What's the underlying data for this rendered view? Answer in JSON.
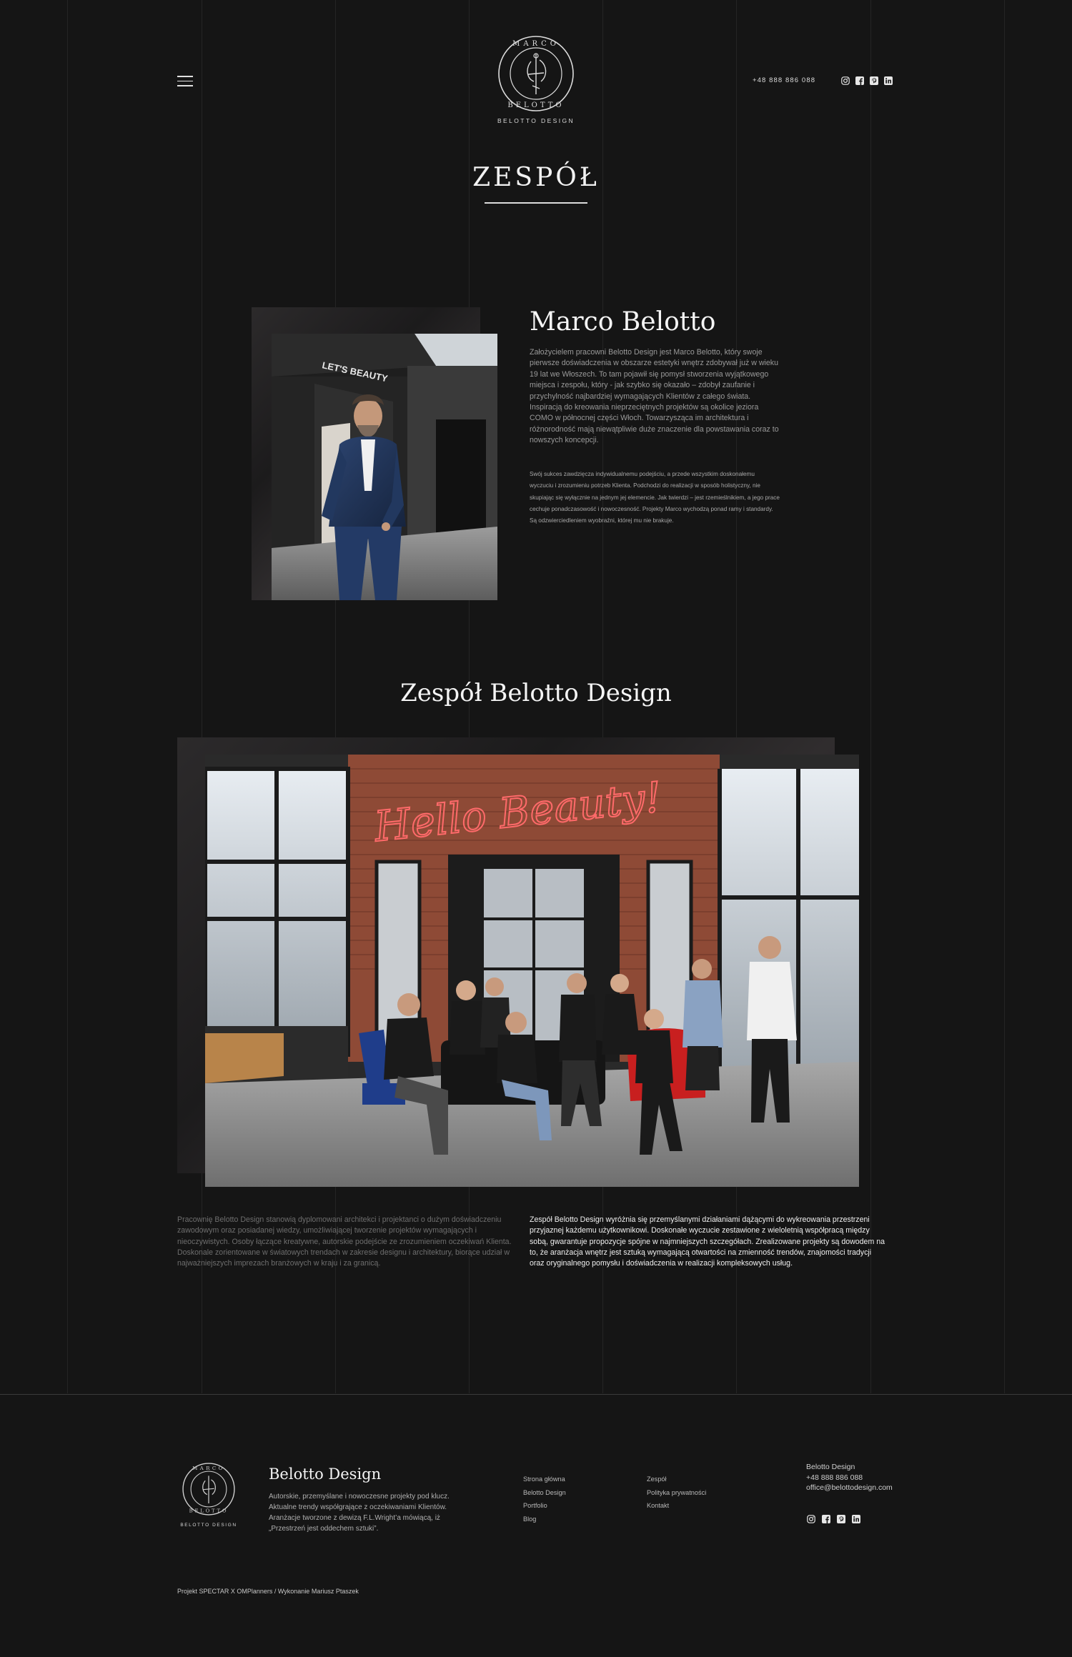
{
  "header": {
    "logo_sub": "BELOTTO DESIGN",
    "phone": "+48 888 886 088",
    "social_icons": [
      "instagram-icon",
      "facebook-icon",
      "pinterest-icon",
      "linkedin-icon"
    ]
  },
  "page_title": "ZESPÓŁ",
  "marco": {
    "name": "Marco Belotto",
    "paragraph1": "Założycielem pracowni Belotto Design jest Marco Belotto, który swoje pierwsze doświadczenia w obszarze estetyki wnętrz zdobywał już w wieku 19 lat we Włoszech. To tam pojawił się pomysł stworzenia wyjątkowego miejsca i zespołu, który - jak szybko się okazało – zdobył zaufanie i przychylność najbardziej wymagających Klientów z całego świata. Inspiracją do kreowania nieprzeciętnych projektów są okolice jeziora COMO w północnej części Włoch. Towarzysząca im architektura i różnorodność mają niewątpliwie duże znaczenie dla powstawania coraz to nowszych koncepcji.",
    "paragraph2": "Swój sukces zawdzięcza indywidualnemu podejściu, a przede wszystkim doskonałemu wyczuciu i zrozumieniu potrzeb Klienta. Podchodzi do realizacji w sposób holistyczny, nie skupiając się wyłącznie na jednym jej elemencie. Jak twierdzi – jest rzemieślnikiem, a jego prace cechuje ponadczasowość i nowoczesność. Projekty Marco wychodzą ponad ramy i standardy. Są odzwierciedleniem wyobraźni, której mu nie brakuje.",
    "photo_sign": "LET'S BEAUTY"
  },
  "team": {
    "title": "Zespół Belotto Design",
    "neon_text": "Hello Beauty!",
    "left_text": "Pracownię Belotto Design stanowią dyplomowani architekci i projektanci o dużym doświadczeniu zawodowym oraz posiadanej wiedzy, umożliwiającej tworzenie projektów wymagających i nieoczywistych. Osoby łączące kreatywne, autorskie podejście ze zrozumieniem oczekiwań Klienta. Doskonale zorientowane w światowych trendach w zakresie designu i architektury, biorące udział w najważniejszych imprezach branżowych w kraju i za granicą.",
    "right_text": "Zespół Belotto Design wyróżnia się przemyślanymi działaniami dążącymi do wykreowania przestrzeni przyjaznej każdemu użytkownikowi. Doskonałe wyczucie zestawione z wieloletnią współpracą między sobą, gwarantuje propozycje spójne w najmniejszych szczegółach. Zrealizowane projekty są dowodem na to, że aranżacja wnętrz jest sztuką wymagającą otwartości na zmienność trendów, znajomości tradycji oraz oryginalnego pomysłu i doświadczenia w realizacji kompleksowych usług."
  },
  "footer": {
    "logo_sub": "BELOTTO DESIGN",
    "brand": "Belotto Design",
    "description": "Autorskie, przemyślane i nowoczesne projekty pod klucz. Aktualne trendy współgrające z oczekiwaniami Klientów. Aranżacje tworzone z dewizą F.L.Wright’a mówiącą, iż „Przestrzeń jest oddechem sztuki”.",
    "nav_col1": [
      "Strona główna",
      "Belotto Design",
      "Portfolio",
      "Blog"
    ],
    "nav_col2": [
      "Zespół",
      "Polityka prywatności",
      "Kontakt"
    ],
    "contact": {
      "name": "Belotto Design",
      "phone": "+48 888 886 088",
      "email": "office@belottodesign.com"
    },
    "credits": "Projekt SPECTAR X OMPlanners / Wykonanie Mariusz Ptaszek"
  },
  "colors": {
    "background": "#151515",
    "text": "#e9e9e9",
    "muted": "#6e6e6e",
    "neon": "#ff5a5a",
    "chair_red": "#c81f1f",
    "chair_blue": "#1f3d8a"
  }
}
